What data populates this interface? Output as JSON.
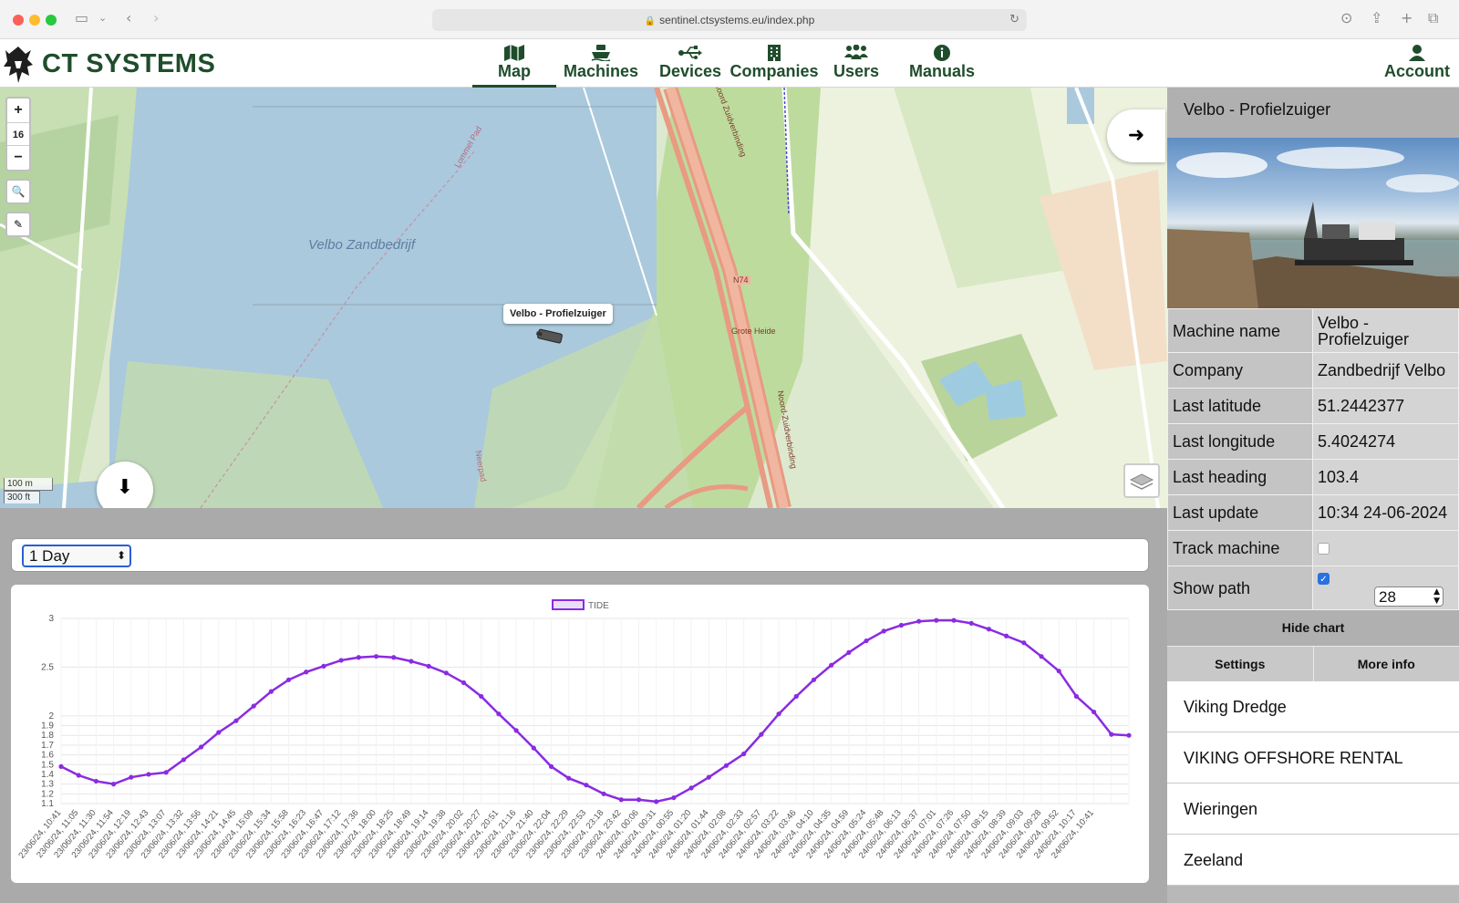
{
  "browser": {
    "url": "sentinel.ctsystems.eu/index.php"
  },
  "header": {
    "brand": "CT SYSTEMS",
    "nav": [
      {
        "label": "Map",
        "icon": "map-icon"
      },
      {
        "label": "Machines",
        "icon": "ship-icon"
      },
      {
        "label": "Devices",
        "icon": "usb-icon"
      },
      {
        "label": "Companies",
        "icon": "building-icon"
      },
      {
        "label": "Users",
        "icon": "users-icon"
      },
      {
        "label": "Manuals",
        "icon": "info-icon"
      }
    ],
    "account": "Account",
    "active_tab": "Map"
  },
  "map": {
    "zoom_level": "16",
    "zoom_in": "+",
    "zoom_out": "−",
    "lake_label": "Velbo Zandbedrijf",
    "marker_label": "Velbo - Profielzuiger",
    "road_labels": [
      "Noord Zuidverbinding",
      "N74",
      "Grote Heide",
      "Noord-Zuidverbinding",
      "Lommel Pad",
      "Neerpad"
    ],
    "scale_metric": "100 m",
    "scale_imperial": "300 ft"
  },
  "range_select": {
    "value": "1 Day"
  },
  "chart_data": {
    "type": "line",
    "series": [
      {
        "name": "TIDE",
        "color": "#8a2be2"
      }
    ],
    "ylim": [
      1.1,
      3
    ],
    "y_ticks": [
      1.1,
      1.2,
      1.3,
      1.4,
      1.5,
      1.6,
      1.7,
      1.8,
      1.9,
      2,
      2.5,
      3
    ],
    "x": [
      "23/06/24, 10:41",
      "23/06/24, 11:05",
      "23/06/24, 11:30",
      "23/06/24, 11:54",
      "23/06/24, 12:19",
      "23/06/24, 12:43",
      "23/06/24, 13:07",
      "23/06/24, 13:32",
      "23/06/24, 13:56",
      "23/06/24, 14:21",
      "23/06/24, 14:45",
      "23/06/24, 15:09",
      "23/06/24, 15:34",
      "23/06/24, 15:58",
      "23/06/24, 16:23",
      "23/06/24, 16:47",
      "23/06/24, 17:12",
      "23/06/24, 17:36",
      "23/06/24, 18:00",
      "23/06/24, 18:25",
      "23/06/24, 18:49",
      "23/06/24, 19:14",
      "23/06/24, 19:38",
      "23/06/24, 20:02",
      "23/06/24, 20:27",
      "23/06/24, 20:51",
      "23/06/24, 21:16",
      "23/06/24, 21:40",
      "23/06/24, 22:04",
      "23/06/24, 22:29",
      "23/06/24, 22:53",
      "23/06/24, 23:18",
      "23/06/24, 23:42",
      "24/06/24, 00:06",
      "24/06/24, 00:31",
      "24/06/24, 00:55",
      "24/06/24, 01:20",
      "24/06/24, 01:44",
      "24/06/24, 02:08",
      "24/06/24, 02:33",
      "24/06/24, 02:57",
      "24/06/24, 03:22",
      "24/06/24, 03:46",
      "24/06/24, 04:10",
      "24/06/24, 04:35",
      "24/06/24, 04:59",
      "24/06/24, 05:24",
      "24/06/24, 05:48",
      "24/06/24, 06:13",
      "24/06/24, 06:37",
      "24/06/24, 07:01",
      "24/06/24, 07:26",
      "24/06/24, 07:50",
      "24/06/24, 08:15",
      "24/06/24, 08:39",
      "24/06/24, 09:03",
      "24/06/24, 09:28",
      "24/06/24, 09:52",
      "24/06/24, 10:17",
      "24/06/24, 10:41"
    ],
    "values": [
      1.48,
      1.39,
      1.33,
      1.3,
      1.37,
      1.4,
      1.42,
      1.55,
      1.68,
      1.83,
      1.95,
      2.1,
      2.25,
      2.37,
      2.45,
      2.51,
      2.57,
      2.6,
      2.61,
      2.6,
      2.56,
      2.51,
      2.44,
      2.34,
      2.2,
      2.02,
      1.85,
      1.67,
      1.48,
      1.36,
      1.29,
      1.2,
      1.14,
      1.14,
      1.12,
      1.16,
      1.26,
      1.37,
      1.49,
      1.61,
      1.81,
      2.02,
      2.2,
      2.37,
      2.52,
      2.65,
      2.77,
      2.87,
      2.93,
      2.97,
      2.98,
      2.98,
      2.95,
      2.89,
      2.82,
      2.75,
      2.61,
      2.46,
      2.2,
      2.04,
      1.81,
      1.8
    ]
  },
  "panel": {
    "title": "Velbo - Profielzuiger",
    "machine_name_label": "Machine name",
    "machine_name": "Velbo - Profielzuiger",
    "company_label": "Company",
    "company": "Zandbedrijf Velbo",
    "lat_label": "Last latitude",
    "lat": "51.2442377",
    "lon_label": "Last longitude",
    "lon": "5.4024274",
    "heading_label": "Last heading",
    "heading": "103.4",
    "update_label": "Last update",
    "update": "10:34 24-06-2024",
    "track_label": "Track machine",
    "track_checked": false,
    "path_label": "Show path",
    "path_checked": true,
    "path_count": "28",
    "hide_chart": "Hide chart",
    "settings": "Settings",
    "more_info": "More info",
    "machine_list": [
      "Viking Dredge",
      "VIKING OFFSHORE RENTAL",
      "Wieringen",
      "Zeeland"
    ]
  }
}
